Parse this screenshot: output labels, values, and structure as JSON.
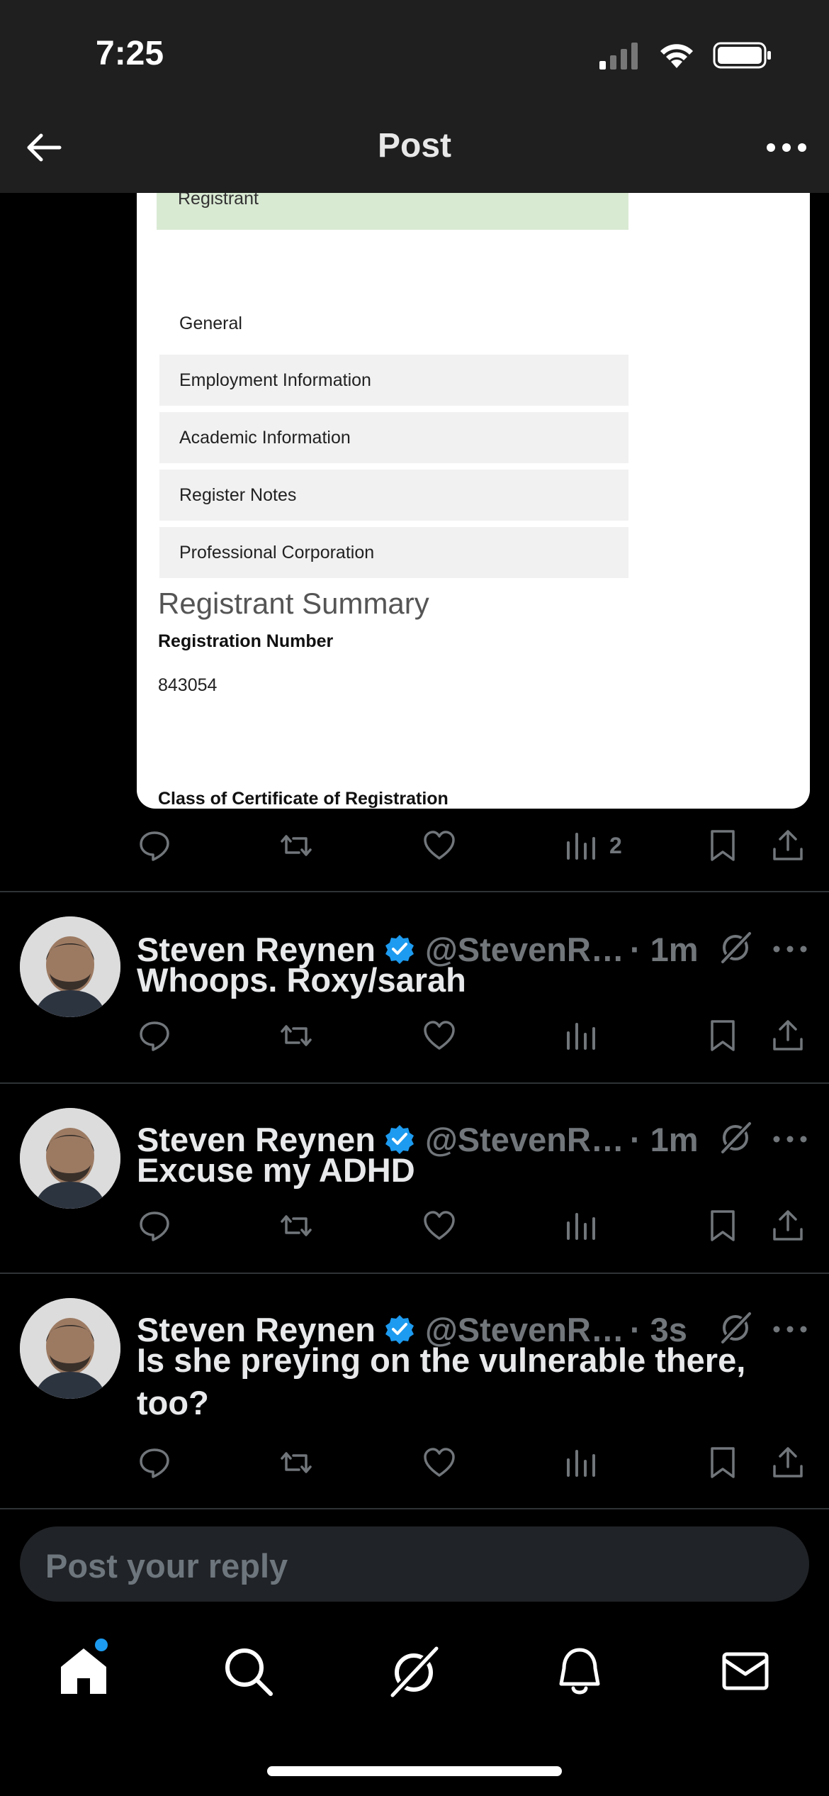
{
  "status_bar": {
    "time": "7:25"
  },
  "header": {
    "title": "Post"
  },
  "document": {
    "highlight_label": "Registrant",
    "general_label": "General",
    "menu_items": [
      "Employment Information",
      "Academic Information",
      "Register Notes",
      "Professional Corporation"
    ],
    "summary_title": "Registrant Summary",
    "registration_number_label": "Registration Number",
    "registration_number": "843054",
    "class_label": "Class of Certificate of Registration"
  },
  "post_actions": {
    "views": "2"
  },
  "replies": [
    {
      "name": "Steven Reynen",
      "handle": "@StevenR…",
      "time": "· 1m",
      "text": "Whoops. Roxy/sarah"
    },
    {
      "name": "Steven Reynen",
      "handle": "@StevenR…",
      "time": "· 1m",
      "text": "Excuse my ADHD"
    },
    {
      "name": "Steven Reynen",
      "handle": "@StevenR…",
      "time": "· 3s",
      "text": "Is she preying on the vulnerable there, too?"
    }
  ],
  "reply_input": {
    "placeholder": "Post your reply"
  },
  "colors": {
    "accent": "#1d9bf0",
    "muted": "#71767b",
    "background": "#000000"
  },
  "nav": [
    "home-icon",
    "search-icon",
    "grok-icon",
    "bell-icon",
    "mail-icon"
  ]
}
